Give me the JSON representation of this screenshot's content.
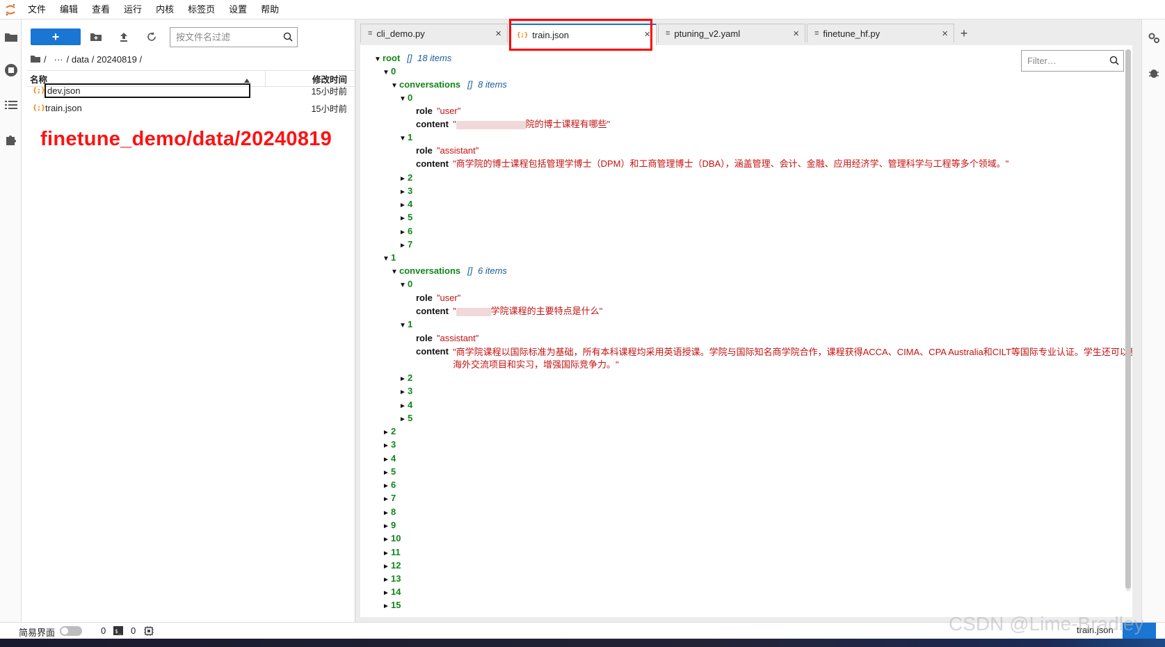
{
  "menu": [
    "文件",
    "编辑",
    "查看",
    "运行",
    "内核",
    "标签页",
    "设置",
    "帮助"
  ],
  "filebrowser": {
    "new_label": "+",
    "search_placeholder": "按文件名过滤",
    "breadcrumb": {
      "root": "/",
      "ellipsis": "···",
      "path": "/ data / 20240819 /"
    },
    "col_name": "名称",
    "col_time": "修改时间",
    "files": [
      {
        "icon": "{;}",
        "name": "dev.json",
        "time": "15小时前"
      },
      {
        "icon": "{;}",
        "name": "train.json",
        "time": "15小时前"
      }
    ],
    "annotation": "finetune_demo/data/20240819"
  },
  "tabs": [
    {
      "label": "cli_demo.py",
      "icon": "≡"
    },
    {
      "label": "train.json",
      "icon": "{;}"
    },
    {
      "label": "ptuning_v2.yaml",
      "icon": "≡"
    },
    {
      "label": "finetune_hf.py",
      "icon": "≡"
    }
  ],
  "tab_add": "+",
  "tab_close": "×",
  "json_viewer": {
    "filter_placeholder": "Filter…",
    "root_key": "root",
    "root_type": "[]",
    "root_count": "18 items",
    "items": {
      "i0": "0",
      "conv_key": "conversations",
      "conv_type": "[]",
      "conv0_count": "8 items",
      "c0": "0",
      "role_key": "role",
      "content_key": "content",
      "role_user": "\"user\"",
      "role_assistant": "\"assistant\"",
      "content0_visible": "院的博士课程有哪些\"",
      "c1": "1",
      "content1": "\"商学院的博士课程包括管理学博士（DPM）和工商管理博士（DBA），涵盖管理、会计、金融、应用经济学、管理科学与工程等多个领域。\"",
      "collapsed0": [
        "2",
        "3",
        "4",
        "5",
        "6",
        "7"
      ],
      "i1": "1",
      "conv1_count": "6 items",
      "content2_visible": "学院课程的主要特点是什么\"",
      "content3": "\"商学院课程以国际标准为基础，所有本科课程均采用英语授课。学院与国际知名商学院合作，课程获得ACCA、CIMA、CPA Australia和CILT等国际专业认证。学生还可以参与海外交流项目和实习，增强国际竞争力。\"",
      "collapsed1": [
        "2",
        "3",
        "4",
        "5"
      ],
      "root_collapsed": [
        "2",
        "3",
        "4",
        "5",
        "6",
        "7",
        "8",
        "9",
        "10",
        "11",
        "12",
        "13",
        "14",
        "15"
      ]
    }
  },
  "status": {
    "simple_mode": "简易界面",
    "kernels": "0",
    "terminals": "0",
    "current_file": "train.json"
  },
  "watermark": "CSDN @Lime-Bradley",
  "colors": {
    "accent": "#1976d2",
    "annotation_red": "#ff1111",
    "json_key": "#11861a",
    "json_string": "#c41010",
    "json_type": "#1a5a9a"
  }
}
